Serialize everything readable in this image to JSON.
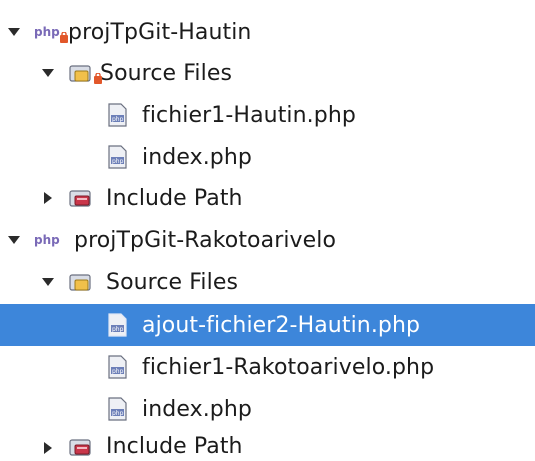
{
  "tree": {
    "projects": [
      {
        "name": "projTpGit-Hautin",
        "expanded": true,
        "has_error_badge": true,
        "source_files": {
          "label": "Source Files",
          "expanded": true,
          "has_error_badge": true,
          "files": [
            "fichier1-Hautin.php",
            "index.php"
          ]
        },
        "include_path": {
          "label": "Include Path",
          "expanded": false
        }
      },
      {
        "name": "projTpGit-Rakotoarivelo",
        "expanded": true,
        "has_error_badge": false,
        "source_files": {
          "label": "Source Files",
          "expanded": true,
          "has_error_badge": false,
          "files": [
            "ajout-fichier2-Hautin.php",
            "fichier1-Rakotoarivelo.php",
            "index.php"
          ]
        },
        "include_path": {
          "label": "Include Path",
          "expanded": false
        }
      }
    ],
    "selected_file": "ajout-fichier2-Hautin.php",
    "selection_color": "#3d86da"
  },
  "icons": {
    "php_project": "php-project-icon",
    "source_folder": "source-folder-icon",
    "include_path": "include-path-icon",
    "php_file": "php-file-icon",
    "error_badge": "error-badge-icon",
    "expanded": "chevron-down-icon",
    "collapsed": "chevron-right-icon"
  }
}
